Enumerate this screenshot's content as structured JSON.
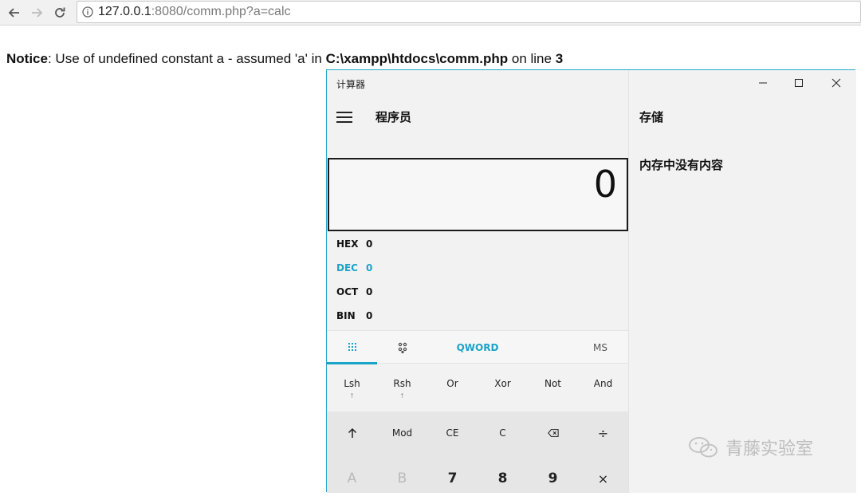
{
  "browser": {
    "url_host": "127.0.0.1",
    "url_rest": ":8080/comm.php?a=calc"
  },
  "notice": {
    "label": "Notice",
    "message": ": Use of undefined constant a - assumed 'a' in ",
    "path": "C:\\xampp\\htdocs\\comm.php",
    "mid": " on line ",
    "line": "3"
  },
  "calculator": {
    "window_title": "计算器",
    "mode_title": "程序员",
    "display_value": "0",
    "radix": [
      {
        "label": "HEX",
        "value": "0",
        "active": false
      },
      {
        "label": "DEC",
        "value": "0",
        "active": true
      },
      {
        "label": "OCT",
        "value": "0",
        "active": false
      },
      {
        "label": "BIN",
        "value": "0",
        "active": false
      }
    ],
    "tabs": {
      "keypad_icon": "full-keypad-icon",
      "bit_icon": "bit-toggle-icon",
      "word_size": "QWORD",
      "memory_store": "MS"
    },
    "bit_ops": [
      {
        "label": "Lsh",
        "sub": "↑"
      },
      {
        "label": "Rsh",
        "sub": "↑"
      },
      {
        "label": "Or",
        "sub": ""
      },
      {
        "label": "Xor",
        "sub": ""
      },
      {
        "label": "Not",
        "sub": ""
      },
      {
        "label": "And",
        "sub": ""
      }
    ],
    "keys_row1": [
      {
        "label": "↑",
        "icon": "shift-arrow-icon"
      },
      {
        "label": "Mod"
      },
      {
        "label": "CE"
      },
      {
        "label": "C"
      },
      {
        "label": "⌫",
        "icon": "backspace-icon"
      },
      {
        "label": "÷"
      }
    ],
    "keys_row2": [
      {
        "label": "A",
        "disabled": true
      },
      {
        "label": "B",
        "disabled": true
      },
      {
        "label": "7"
      },
      {
        "label": "8"
      },
      {
        "label": "9"
      },
      {
        "label": "×"
      }
    ],
    "memory": {
      "title": "存储",
      "empty_text": "内存中没有内容"
    }
  },
  "watermark": {
    "text": "青藤实验室"
  },
  "colors": {
    "accent": "#1aa3c8",
    "window_border": "#2aa7c7"
  }
}
